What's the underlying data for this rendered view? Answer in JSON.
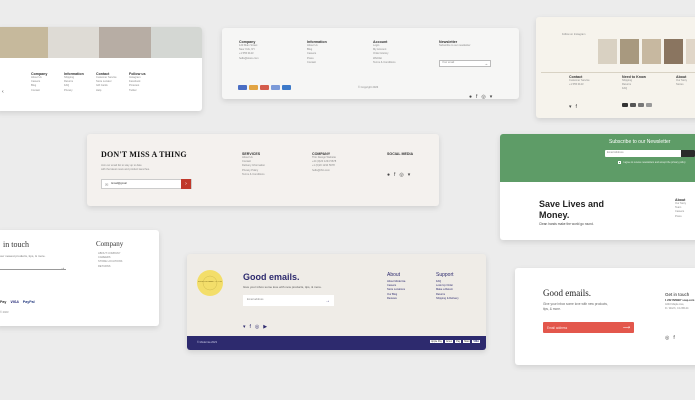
{
  "colors": {
    "background": "#ececec",
    "green": "#5e9c67",
    "navy": "#2d2a6e",
    "red": "#e3574c",
    "crimson": "#c0392b"
  },
  "card1": {
    "cols": [
      {
        "title": "Company",
        "items": [
          "About Us",
          "Careers",
          "Blog",
          "Contact"
        ]
      },
      {
        "title": "Information",
        "items": [
          "Shipping",
          "Returns",
          "FAQ",
          "Privacy"
        ]
      },
      {
        "title": "Contact",
        "items": [
          "Customer Service",
          "Store Locator",
          "Gift Cards",
          "Help"
        ]
      },
      {
        "title": "Follow us",
        "items": [
          "Instagram",
          "Facebook",
          "Pinterest",
          "Twitter"
        ]
      }
    ]
  },
  "card2": {
    "cols": [
      {
        "title": "Company",
        "items": [
          "123 Main Street",
          "New York, NY",
          "+1 555 0123",
          "hello@store.com"
        ]
      },
      {
        "title": "Information",
        "items": [
          "About Us",
          "Blog",
          "Careers",
          "Press",
          "Contact"
        ]
      },
      {
        "title": "Account",
        "items": [
          "Login",
          "My Account",
          "Order History",
          "Wishlist",
          "Terms & Conditions"
        ]
      },
      {
        "title": "Newsletter",
        "items": [
          "Subscribe to our newsletter"
        ]
      }
    ],
    "email_placeholder": "Your email",
    "copyright": "© Copyright 2023"
  },
  "card3": {
    "headline": "Follow on Instagram",
    "cols": [
      {
        "title": "Contact",
        "items": [
          "Customer Service",
          "+1 555 0123"
        ]
      },
      {
        "title": "Need to Know",
        "items": [
          "Shipping",
          "Returns",
          "FAQ"
        ]
      },
      {
        "title": "About",
        "items": [
          "Our Story",
          "Stores"
        ]
      }
    ]
  },
  "card4": {
    "title": "DON'T MISS A THING",
    "subtitle_lines": [
      "Join our email list to stay up to date",
      "with the latest news and product launches."
    ],
    "email_value": "Email@gmail",
    "cols": [
      {
        "title": "SERVICES",
        "items": [
          "About Us",
          "Contact",
          "Delivery Information",
          "Privacy Policy",
          "Terms & Conditions"
        ]
      },
      {
        "title": "COMPANY",
        "items": [
          "Thin Design Website",
          "+44 (0)20 1234 5678",
          "",
          "+1 (0)20 1234 5678",
          "hello@thin.com"
        ]
      },
      {
        "title": "SOCIAL MEDIA",
        "items": []
      }
    ]
  },
  "card5": {
    "newsletter_title": "Subscribe to our Newsletter",
    "email_placeholder": "Email Address",
    "consent": "I agree to receive newsletters and accept the privacy policy",
    "headline_line1": "Save Lives and",
    "headline_line2": "Money.",
    "tagline": "Clean hands make the world go round.",
    "about_title": "About",
    "about_items": [
      "Our Story",
      "Team",
      "Careers",
      "Press"
    ]
  },
  "card6": {
    "heading": "in touch",
    "subtitle": "our newest products, tips, & more.",
    "company_title": "Company",
    "company_items": [
      "ABOUT COMPANY",
      "CAREERS",
      "STORE LOCATIONS",
      "RETURNS"
    ],
    "payments": [
      "Pay",
      "VISA",
      "PayPal"
    ],
    "copyright": "© 2023"
  },
  "card7": {
    "headline": "Good emails.",
    "subtitle": "Give your inbox some love with new products, tips, & more.",
    "email_placeholder": "Email address",
    "badge_text": "FROM OUR FAMILY TO YOURS",
    "about_title": "About",
    "about_items": [
      "About Modernia",
      "Careers",
      "Store Locations",
      "Our Blog",
      "Reviews"
    ],
    "support_title": "Support",
    "support_items": [
      "FAQ",
      "Look Up Order",
      "Make a Return",
      "Returns",
      "Shipping & Delivery"
    ],
    "copyright": "© Modernia 2023",
    "payments": [
      "Apple Pay",
      "Amex",
      "Pay",
      "Mast",
      "VISA"
    ]
  },
  "card8": {
    "headline": "Good emails.",
    "subtitle_line1": "Give your inbox some love with new products,",
    "subtitle_line2": "tips, & more.",
    "button_label": "Email address",
    "contact_title": "Get in touch",
    "contact_lines": [
      "1 222 8VIBBY soap.com",
      "",
      "4240 Maple Ave,",
      "Ft. Worth, CA 95124"
    ]
  }
}
